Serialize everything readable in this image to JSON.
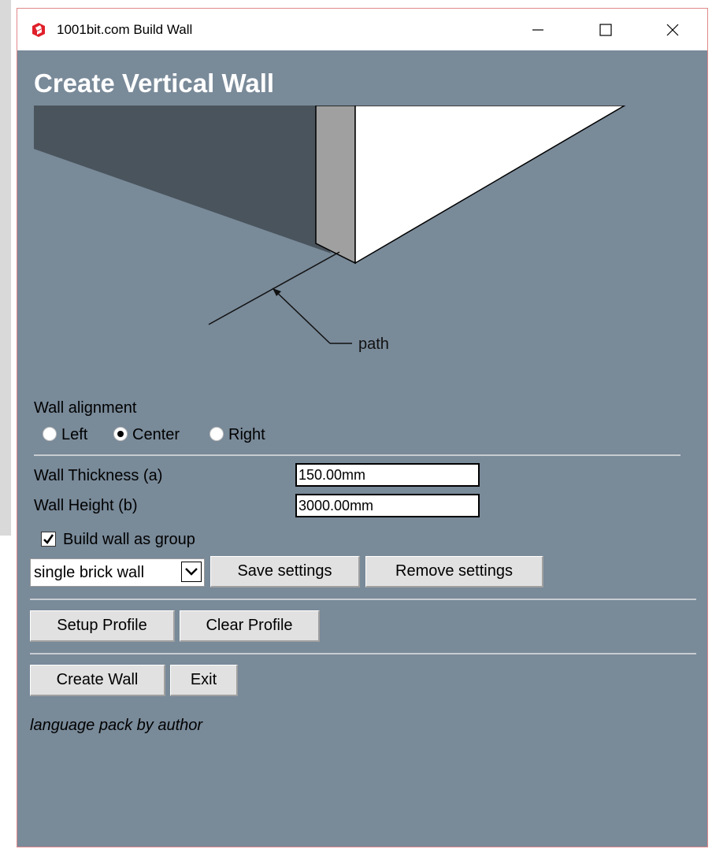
{
  "window": {
    "title": "1001bit.com Build Wall"
  },
  "heading": "Create Vertical Wall",
  "illustration": {
    "path_label": "path"
  },
  "alignment": {
    "label": "Wall alignment",
    "options": [
      "Left",
      "Center",
      "Right"
    ],
    "selected": "Center"
  },
  "thickness": {
    "label": "Wall Thickness (a)",
    "value": "150.00mm"
  },
  "height": {
    "label": "Wall Height (b)",
    "value": "3000.00mm"
  },
  "group_checkbox": {
    "label": "Build wall as group",
    "checked": true
  },
  "preset": {
    "selected": "single brick wall"
  },
  "buttons": {
    "save_settings": "Save settings",
    "remove_settings": "Remove settings",
    "setup_profile": "Setup Profile",
    "clear_profile": "Clear Profile",
    "create_wall": "Create Wall",
    "exit": "Exit"
  },
  "footer": "language pack by author",
  "colors": {
    "window_bg": "#798a99",
    "accent_icon": "#e0202a",
    "wall_shadow": "#4a545d",
    "wall_side": "#a0a0a0",
    "wall_face": "#ffffff"
  }
}
